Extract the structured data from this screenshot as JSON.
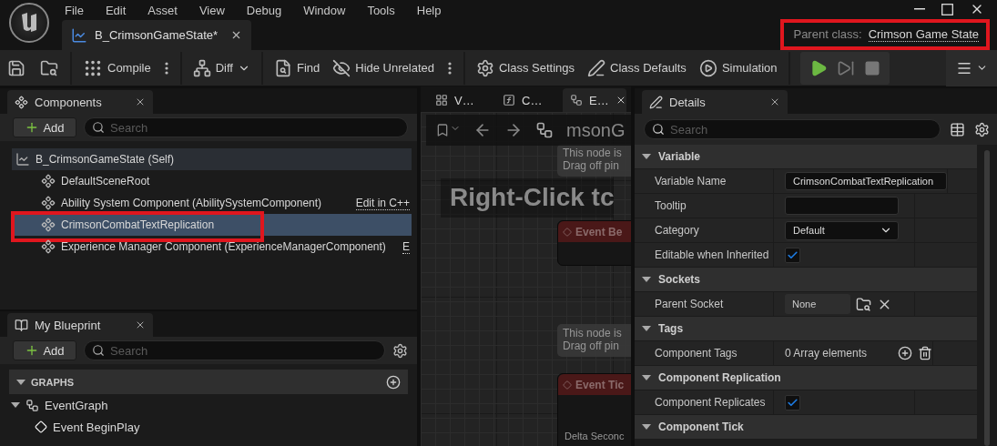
{
  "menu": [
    {
      "label": "File"
    },
    {
      "label": "Edit"
    },
    {
      "label": "Asset"
    },
    {
      "label": "View"
    },
    {
      "label": "Debug"
    },
    {
      "label": "Window"
    },
    {
      "label": "Tools"
    },
    {
      "label": "Help"
    }
  ],
  "document_tab": {
    "label": "B_CrimsonGameState*"
  },
  "parent_class": {
    "label": "Parent class:",
    "value": "Crimson Game State",
    "highlighted": true
  },
  "toolbar_groups": [
    {
      "buttons": [
        {
          "label": "Compile",
          "more": true
        }
      ]
    },
    {
      "buttons": [
        {
          "label": "Diff",
          "dropdown": true
        }
      ]
    },
    {
      "buttons": [
        {
          "label": "Find"
        },
        {
          "label": "Hide Unrelated",
          "more": true
        }
      ]
    },
    {
      "buttons": [
        {
          "label": "Class Settings"
        },
        {
          "label": "Class Defaults"
        },
        {
          "label": "Simulation"
        }
      ]
    }
  ],
  "components": {
    "tab": "Components",
    "add": "Add",
    "search_placeholder": "Search",
    "tree": [
      {
        "label": "B_CrimsonGameState (Self)",
        "selected": false,
        "children": [
          {
            "label": "DefaultSceneRoot",
            "selected": false
          },
          {
            "label": "Ability System Component (AbilitySystemComponent)",
            "action": "Edit in C++",
            "selected": false
          },
          {
            "label": "CrimsonCombatTextReplication",
            "selected": true,
            "highlighted": true
          },
          {
            "label": "Experience Manager Component (ExperienceManagerComponent)",
            "action": "E",
            "selected": false
          }
        ]
      }
    ]
  },
  "my_blueprint": {
    "tab": "My Blueprint",
    "add": "Add",
    "search_placeholder": "Search",
    "sections": [
      {
        "title": "GRAPHS",
        "expanded": true,
        "items": [
          {
            "label": "EventGraph",
            "expanded": true,
            "children": [
              {
                "label": "Event BeginPlay"
              }
            ]
          }
        ]
      }
    ]
  },
  "graph": {
    "tabs": [
      {
        "label": "V…",
        "selected": false
      },
      {
        "label": "C…",
        "selected": false
      },
      {
        "label": "E…",
        "selected": true
      }
    ],
    "breadcrumb": "msonG",
    "hint": "Right-Click tc",
    "nodes": [
      {
        "comment": [
          "This node is",
          "Drag off pin"
        ],
        "title": "Event Be"
      },
      {
        "comment": [
          "This node is",
          "Drag off pin"
        ],
        "title": "Event Tic",
        "pin": "Delta Seconc"
      }
    ]
  },
  "details": {
    "tab": "Details",
    "search_placeholder": "Search",
    "sections": [
      {
        "title": "Variable",
        "expanded": true,
        "rows": [
          {
            "kind": "text",
            "label": "Variable Name",
            "value": "CrimsonCombatTextReplication"
          },
          {
            "kind": "text",
            "label": "Tooltip"
          },
          {
            "kind": "dropdown",
            "label": "Category",
            "value": "Default"
          },
          {
            "kind": "checkbox",
            "label": "Editable when Inherited",
            "checked": true
          }
        ]
      },
      {
        "title": "Sockets",
        "expanded": true,
        "rows": [
          {
            "kind": "socket",
            "label": "Parent Socket",
            "value": "None"
          }
        ]
      },
      {
        "title": "Tags",
        "expanded": true,
        "rows": [
          {
            "kind": "array",
            "label": "Component Tags",
            "value": "0 Array elements"
          }
        ]
      },
      {
        "title": "Component Replication",
        "expanded": true,
        "rows": [
          {
            "kind": "checkbox",
            "label": "Component Replicates",
            "checked": true
          }
        ]
      },
      {
        "title": "Component Tick",
        "expanded": true
      }
    ]
  }
}
